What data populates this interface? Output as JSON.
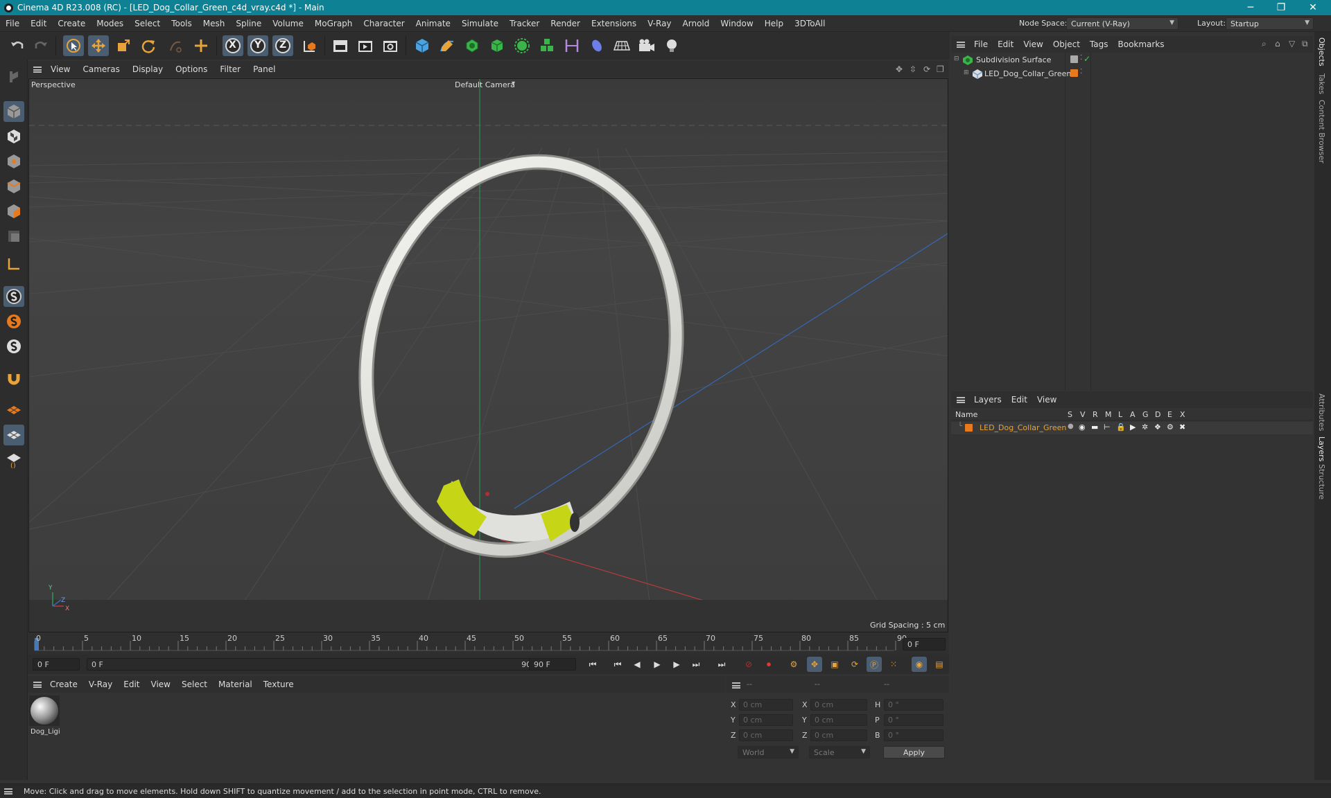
{
  "window": {
    "title": "Cinema 4D R23.008 (RC) - [LED_Dog_Collar_Green_c4d_vray.c4d *] - Main",
    "controls": [
      "─",
      "❐",
      "✕"
    ]
  },
  "menubar": {
    "items": [
      "File",
      "Edit",
      "Create",
      "Modes",
      "Select",
      "Tools",
      "Mesh",
      "Spline",
      "Volume",
      "MoGraph",
      "Character",
      "Animate",
      "Simulate",
      "Tracker",
      "Render",
      "Extensions",
      "V-Ray",
      "Arnold",
      "Window",
      "Help",
      "3DToAll"
    ],
    "node_space_label": "Node Space:",
    "node_space_value": "Current (V-Ray)",
    "layout_label": "Layout:",
    "layout_value": "Startup"
  },
  "toolbar": {
    "axis_labels": [
      "X",
      "Y",
      "Z"
    ]
  },
  "viewport": {
    "menu": [
      "View",
      "Cameras",
      "Display",
      "Options",
      "Filter",
      "Panel"
    ],
    "label": "Perspective",
    "camera": "Default Camera",
    "grid_spacing": "Grid Spacing : 5 cm",
    "axis_y": "Y",
    "axis_z": "Z",
    "axis_x": "X"
  },
  "timeline": {
    "ticks": [
      "0",
      "5",
      "10",
      "15",
      "20",
      "25",
      "30",
      "35",
      "40",
      "45",
      "50",
      "55",
      "60",
      "65",
      "70",
      "75",
      "80",
      "85",
      "90"
    ],
    "current_frame": "0 F",
    "start": "0 F",
    "range_start": "0 F",
    "range_end": "90 F",
    "end": "90 F"
  },
  "materials": {
    "menu": [
      "Create",
      "V-Ray",
      "Edit",
      "View",
      "Select",
      "Material",
      "Texture"
    ],
    "items": [
      {
        "name": "Dog_Ligi"
      }
    ]
  },
  "coordinates": {
    "headers": [
      "--",
      "--",
      "--"
    ],
    "rows": [
      {
        "a": "X",
        "av": "0 cm",
        "b": "X",
        "bv": "0 cm",
        "c": "H",
        "cv": "0 °"
      },
      {
        "a": "Y",
        "av": "0 cm",
        "b": "Y",
        "bv": "0 cm",
        "c": "P",
        "cv": "0 °"
      },
      {
        "a": "Z",
        "av": "0 cm",
        "b": "Z",
        "bv": "0 cm",
        "c": "B",
        "cv": "0 °"
      }
    ],
    "space": "World",
    "mode": "Scale",
    "apply": "Apply"
  },
  "objects": {
    "menu": [
      "File",
      "Edit",
      "View",
      "Object",
      "Tags",
      "Bookmarks"
    ],
    "items": [
      {
        "name": "Subdivision Surface"
      },
      {
        "name": "LED_Dog_Collar_Green"
      }
    ]
  },
  "layers": {
    "menu": [
      "Layers",
      "Edit",
      "View"
    ],
    "columns": [
      "Name",
      "S",
      "V",
      "R",
      "M",
      "L",
      "A",
      "G",
      "D",
      "E",
      "X"
    ],
    "items": [
      {
        "name": "LED_Dog_Collar_Green"
      }
    ]
  },
  "side_tabs": [
    "Objects",
    "Takes",
    "Content Browser",
    "Attributes",
    "Layers",
    "Structure"
  ],
  "status": "Move: Click and drag to move elements. Hold down SHIFT to quantize movement / add to the selection in point mode, CTRL to remove.",
  "colors": {
    "title_bar": "#0e8294",
    "accent_orange": "#e87a1e",
    "selection_blue": "#4b5d71",
    "layer_text": "#e8a33a"
  }
}
